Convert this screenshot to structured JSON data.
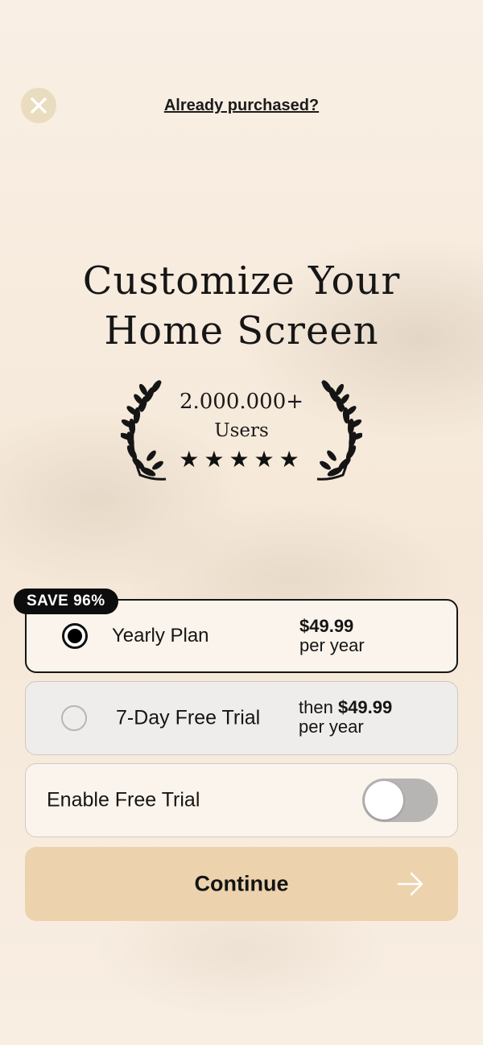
{
  "header": {
    "close_icon": "close-icon",
    "already_purchased": "Already purchased?"
  },
  "hero": {
    "title_line1": "Customize Your",
    "title_line2": "Home Screen",
    "users_count": "2.000.000+",
    "users_label": "Users",
    "stars": "★★★★★",
    "rating_stars": 5
  },
  "plans": [
    {
      "badge": "SAVE 96%",
      "name": "Yearly Plan",
      "price_prefix": "",
      "price": "$49.99",
      "period": "per year",
      "selected": true
    },
    {
      "name": "7-Day Free Trial",
      "price_prefix": "then",
      "price": "$49.99",
      "period": "per year",
      "selected": false
    }
  ],
  "free_trial_toggle": {
    "label": "Enable Free Trial",
    "enabled": false
  },
  "continue": {
    "label": "Continue",
    "icon": "arrow-right-icon"
  },
  "colors": {
    "background": "#f7ebdd",
    "accent_button": "#ecd3ad",
    "close_button": "#eadcbe",
    "badge": "#0d0d0d",
    "toggle_off": "#b6b5b3"
  }
}
